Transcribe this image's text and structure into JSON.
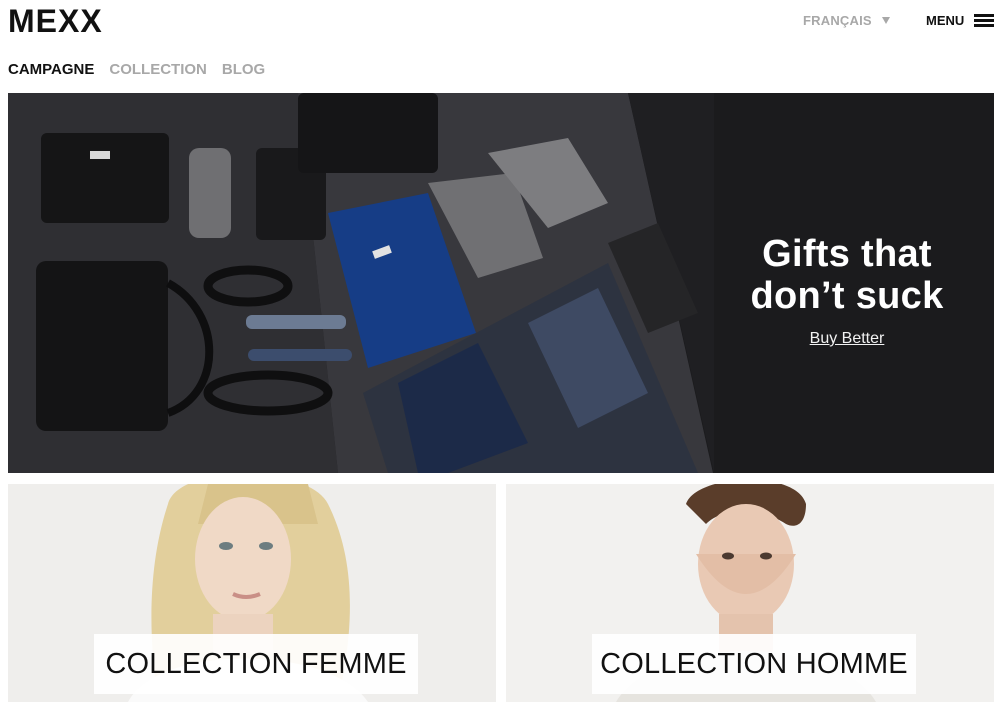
{
  "header": {
    "logo": "MEXX",
    "language": "FRANÇAIS",
    "menu_label": "MENU"
  },
  "nav": {
    "items": [
      {
        "label": "CAMPAGNE",
        "active": true
      },
      {
        "label": "COLLECTION",
        "active": false
      },
      {
        "label": "BLOG",
        "active": false
      }
    ]
  },
  "hero": {
    "title_line1": "Gifts that",
    "title_line2": "don’t suck",
    "link": "Buy Better"
  },
  "collections": {
    "women": "COLLECTION FEMME",
    "men": "COLLECTION HOMME"
  },
  "colors": {
    "accent_inactive": "#a8a8a8",
    "hero_bg": "#1b1b1d",
    "text": "#111111"
  }
}
